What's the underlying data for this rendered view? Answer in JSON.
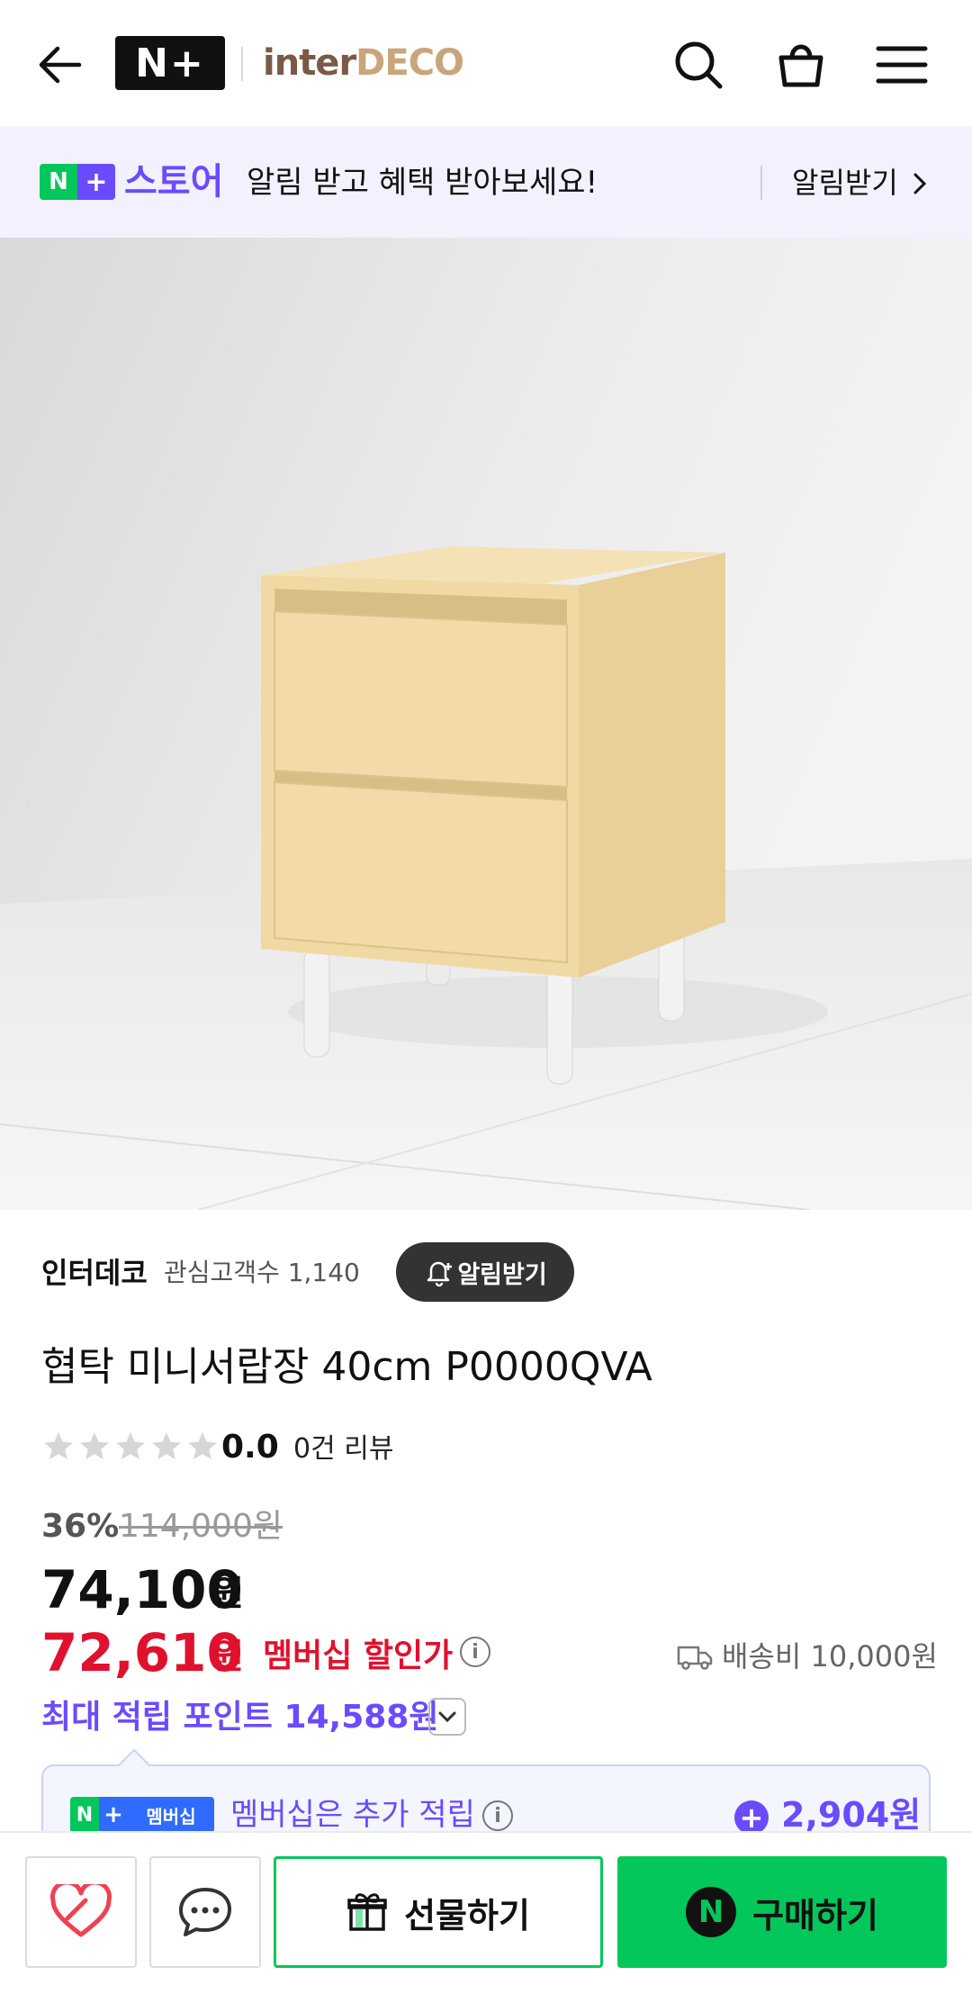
{
  "header": {
    "nplus_logo": "N+",
    "brand_a": "inter",
    "brand_b": "DECO"
  },
  "notice": {
    "chip_n": "N",
    "chip_plus": "+",
    "store": "스토어",
    "text": "알림 받고 혜택 받아보세요!",
    "action": "알림받기"
  },
  "seller": {
    "name": "인터데코",
    "fans": "관심고객수 1,140",
    "alarm": "알림받기"
  },
  "product": {
    "title": "협탁 미니서랍장 40cm P0000QVA",
    "rating": "0.0",
    "reviews": "0건 리뷰",
    "discount": "36%",
    "original_price": "114,000원",
    "price": "74,100",
    "won": "원",
    "member_price": "72,610",
    "member_label": "멤버십 할인가",
    "shipping": "배송비 10,000원",
    "points": "최대 적립 포인트 14,588원"
  },
  "membership_box": {
    "chip_n": "N",
    "chip_plus": "+",
    "chip_text": "멤버십",
    "text": "멤버십은 추가 적립",
    "amount": "2,904원"
  },
  "bottom_bar": {
    "gift": "선물하기",
    "buy": "구매하기",
    "buy_icon": "N"
  },
  "colors": {
    "naver_green": "#03c75a",
    "purple": "#6a4bff",
    "red": "#e0112d"
  }
}
